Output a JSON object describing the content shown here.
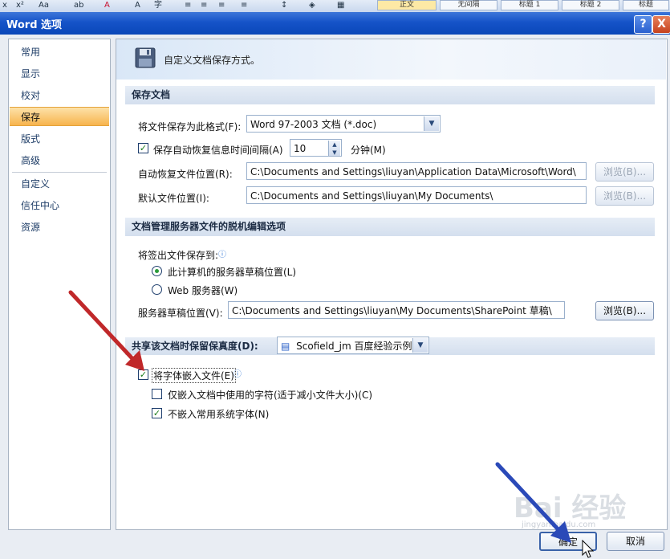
{
  "toolbar": {
    "sub": "x",
    "sup": "x²",
    "font_size": "Aa",
    "highlight": "ab",
    "font_color": "A",
    "char_border": "A",
    "enclose": "字",
    "styles": [
      "正文",
      "无间隔",
      "标题 1",
      "标题 2",
      "标题"
    ]
  },
  "window": {
    "title": "Word 选项",
    "help": "?",
    "close": "X"
  },
  "nav": {
    "items": [
      {
        "label": "常用"
      },
      {
        "label": "显示"
      },
      {
        "label": "校对"
      },
      {
        "label": "保存"
      },
      {
        "label": "版式"
      },
      {
        "label": "高级"
      },
      {
        "label": "自定义"
      },
      {
        "label": "信任中心"
      },
      {
        "label": "资源"
      }
    ],
    "selected": "保存"
  },
  "banner": {
    "text": "自定义文档保存方式。"
  },
  "save_docs": {
    "header": "保存文档",
    "format_label": "将文件保存为此格式(F):",
    "format_value": "Word 97-2003 文档 (*.doc)",
    "autorecover_label": "保存自动恢复信息时间间隔(A)",
    "autorecover_checked": true,
    "autorecover_value": "10",
    "minutes_label": "分钟(M)",
    "autorecover_location_label": "自动恢复文件位置(R):",
    "autorecover_location_value": "C:\\Documents and Settings\\liuyan\\Application Data\\Microsoft\\Word\\",
    "browse1": "浏览(B)...",
    "default_location_label": "默认文件位置(I):",
    "default_location_value": "C:\\Documents and Settings\\liuyan\\My Documents\\",
    "browse2": "浏览(B)..."
  },
  "offline": {
    "header": "文档管理服务器文件的脱机编辑选项",
    "save_to_label": "将签出文件保存到:",
    "radio_local": "此计算机的服务器草稿位置(L)",
    "radio_web": "Web 服务器(W)",
    "selected": "local",
    "drafts_label": "服务器草稿位置(V):",
    "drafts_value": "C:\\Documents and Settings\\liuyan\\My Documents\\SharePoint 草稿\\",
    "browse": "浏览(B)..."
  },
  "fidelity": {
    "header": "共享该文档时保留保真度(D):",
    "document": "Scofield_jm 百度经验示例",
    "embed_fonts": "将字体嵌入文件(E)",
    "embed_fonts_checked": true,
    "embed_used_chars": "仅嵌入文档中使用的字符(适于减小文件大小)(C)",
    "embed_used_chars_checked": false,
    "no_common_fonts": "不嵌入常用系统字体(N)",
    "no_common_fonts_checked": true
  },
  "footer": {
    "ok": "确定",
    "cancel": "取消"
  },
  "watermark": {
    "logo": "Bai 经验",
    "url": "jingyan.baidu.com"
  },
  "colors": {
    "title_bar": "#1553c8",
    "selected_nav": "#f7b44d",
    "annotation_red": "#c0282a",
    "annotation_blue": "#2a49b8"
  }
}
